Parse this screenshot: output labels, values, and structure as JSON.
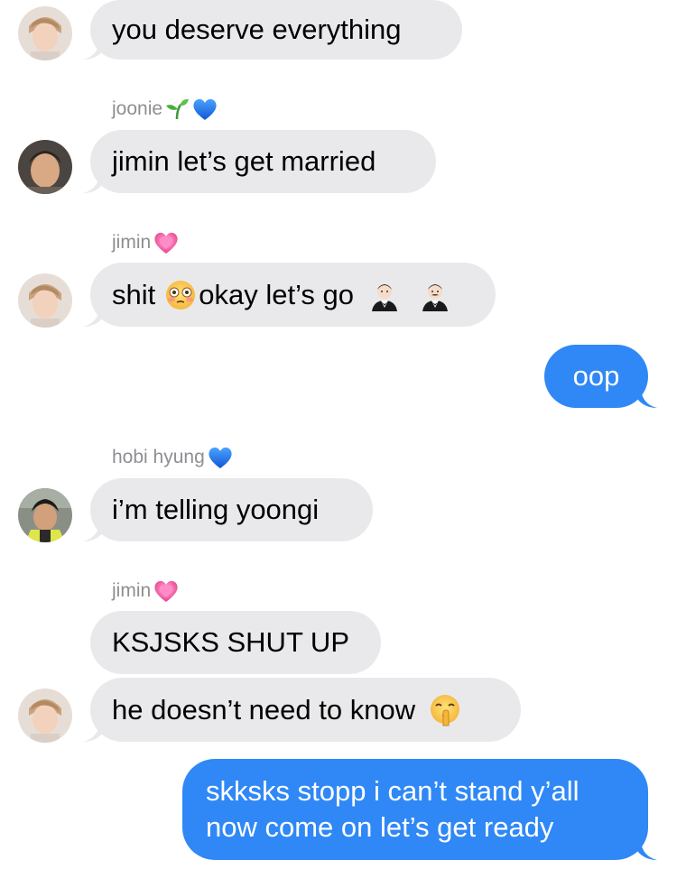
{
  "colors": {
    "incoming_bubble": "#e9e9eb",
    "outgoing_bubble": "#2f88f6",
    "sender_name": "#8e8e93",
    "background": "#ffffff"
  },
  "messages": [
    {
      "id": "m1",
      "direction": "incoming",
      "sender": "jimin",
      "text": "you deserve everything",
      "avatar": "avatar-jimin"
    },
    {
      "id": "m2",
      "direction": "incoming",
      "sender_label": "joonie",
      "sender_emojis": [
        "seedling-icon",
        "blue-heart-icon"
      ],
      "text": "jimin let’s get married",
      "avatar": "avatar-joonie"
    },
    {
      "id": "m3",
      "direction": "incoming",
      "sender_label": "jimin",
      "sender_emojis": [
        "growing-heart-icon"
      ],
      "text_before_emoji": "shit",
      "text_after_emoji": "okay let’s go",
      "inline_emojis": [
        "flushed-face-icon",
        "man-in-tuxedo-icon",
        "man-in-tuxedo-icon"
      ],
      "avatar": "avatar-jimin"
    },
    {
      "id": "m4",
      "direction": "outgoing",
      "text": "oop"
    },
    {
      "id": "m5",
      "direction": "incoming",
      "sender_label": "hobi hyung",
      "sender_emojis": [
        "blue-heart-icon"
      ],
      "text": "i’m telling yoongi",
      "avatar": "avatar-hobi"
    },
    {
      "id": "m6",
      "direction": "incoming",
      "sender_label": "jimin",
      "sender_emojis": [
        "growing-heart-icon"
      ],
      "text": "KSJSKS SHUT UP"
    },
    {
      "id": "m7",
      "direction": "incoming",
      "text": "he doesn’t need to know",
      "inline_emojis": [
        "shushing-face-icon"
      ],
      "avatar": "avatar-jimin"
    },
    {
      "id": "m8",
      "direction": "outgoing",
      "lines": [
        "skksks stopp i can’t stand y’all",
        "now come on let’s get ready"
      ]
    }
  ]
}
